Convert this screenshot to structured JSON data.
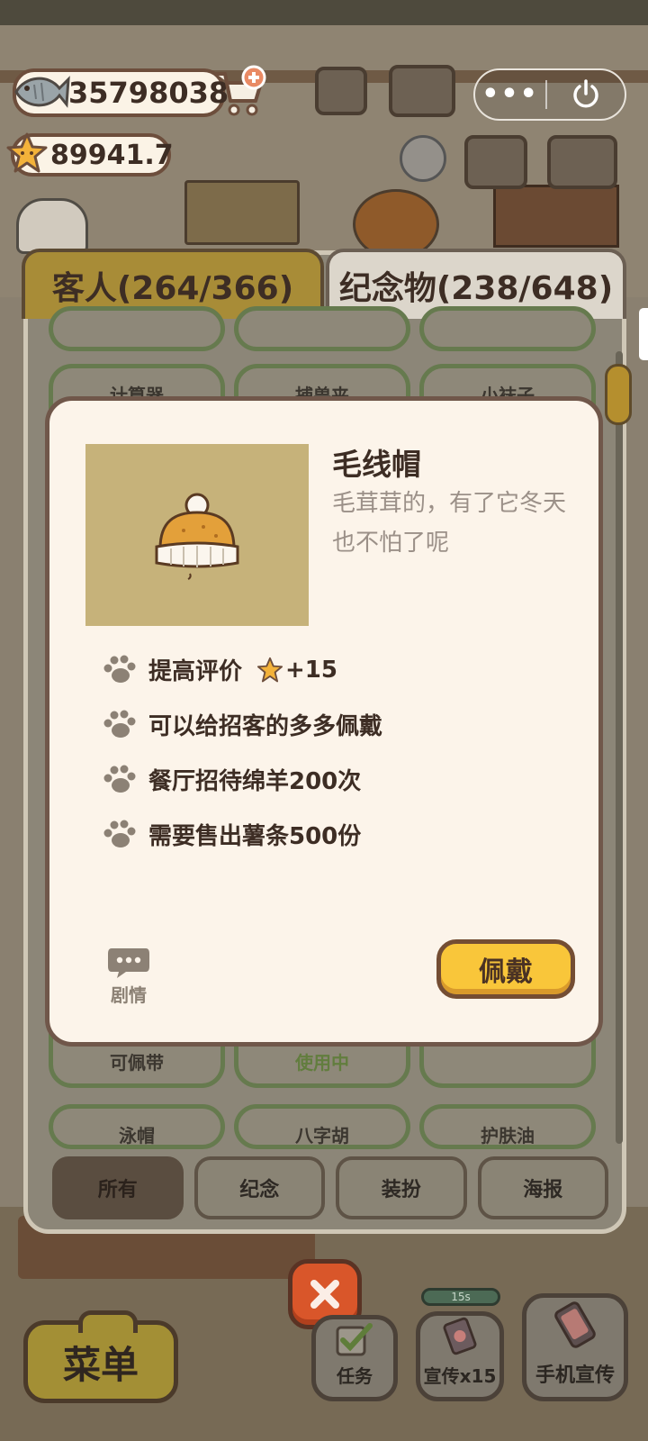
{
  "hud": {
    "fish_count": "35798038",
    "star_rating": "89941.7"
  },
  "mini_program": {
    "more_label": "•••"
  },
  "tabs": {
    "guests": "客人(264/366)",
    "souvenirs": "纪念物(238/648)"
  },
  "grid": {
    "row2": [
      "计算器",
      "捕兽夹",
      "小袜子"
    ],
    "status_row": [
      "可佩带",
      "使用中",
      ""
    ],
    "row_last": [
      "泳帽",
      "八字胡",
      "护肤油"
    ]
  },
  "item_detail": {
    "name": "毛线帽",
    "description": "毛茸茸的，有了它冬天也不怕了呢",
    "props": {
      "rating_label": "提高评价",
      "rating_bonus": "+15",
      "wear_hint": "可以给招客的多多佩戴",
      "condition_sheep": "餐厅招待绵羊200次",
      "condition_fries": "需要售出薯条500份"
    },
    "story_label": "剧情",
    "wear_button": "佩戴"
  },
  "filters": [
    "所有",
    "纪念",
    "装扮",
    "海报"
  ],
  "bottom_bar": {
    "menu": "菜单",
    "task": "任务",
    "promo": "宣传x15",
    "phone_promo": "手机宣传",
    "timer": "15s"
  },
  "colors": {
    "accent_yellow": "#f9c63a",
    "panel_border": "#70574a",
    "card_green": "#667a4e",
    "close_orange": "#d9562a"
  }
}
